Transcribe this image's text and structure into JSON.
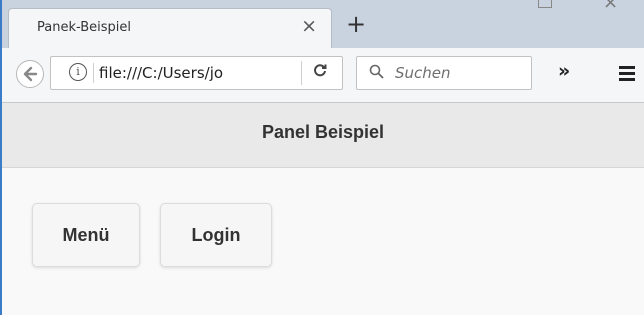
{
  "browser": {
    "tab_title": "Panek-Beispiel",
    "tab_close": "×",
    "new_tab": "+",
    "url": "file:///C:/Users/jo",
    "reload": "C",
    "search_placeholder": "Suchen",
    "overflow": "»"
  },
  "page": {
    "header_title": "Panel Beispiel",
    "buttons": [
      {
        "label": "Menü"
      },
      {
        "label": "Login"
      }
    ]
  },
  "icons": {
    "back": "back-arrow-icon",
    "info": "info-icon",
    "search": "magnifier-icon",
    "menu": "hamburger-icon"
  },
  "colors": {
    "window_border": "#3a7cc7",
    "header_bg": "#e9e9e9",
    "tabstrip_bg": "#c9d2df"
  }
}
